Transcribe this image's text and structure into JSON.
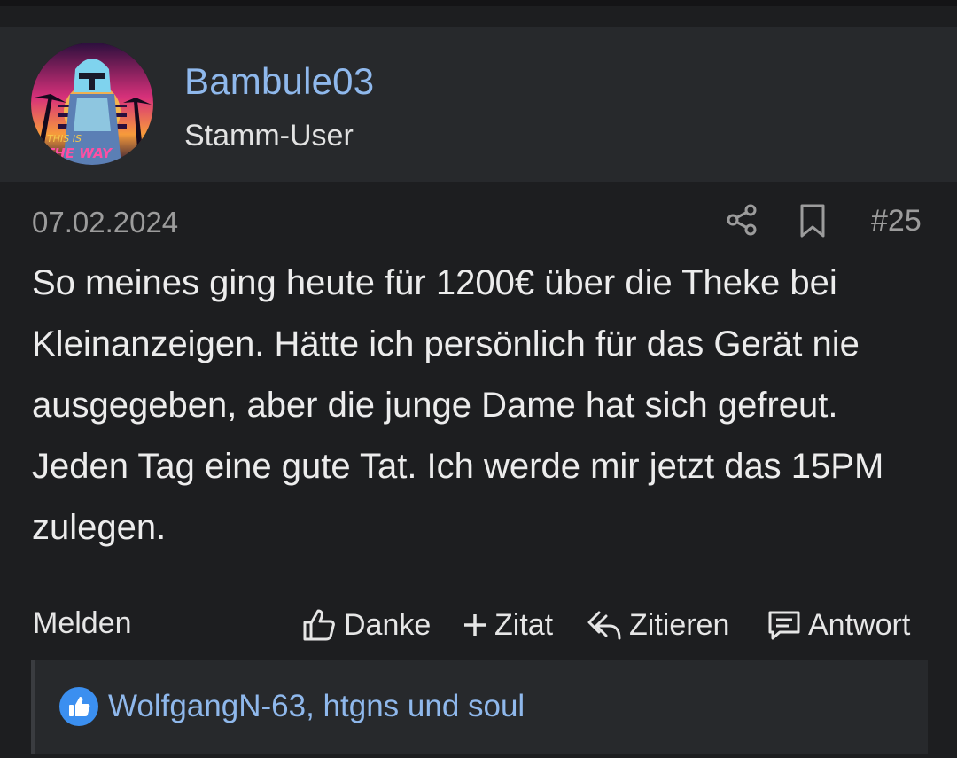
{
  "author": {
    "username": "Bambule03",
    "title": "Stamm-User",
    "avatar_text_line1": "THIS IS",
    "avatar_text_line2": "THE WAY"
  },
  "post": {
    "date": "07.02.2024",
    "number": "#25",
    "body": "So meines ging heute für 1200€ über die Theke bei Kleinanzeigen. Hätte ich persönlich für das Gerät nie ausgegeben, aber die junge Dame hat sich gefreut. Jeden Tag eine gute Tat. Ich werde mir jetzt das 15PM zulegen."
  },
  "actions": {
    "report": "Melden",
    "like": "Danke",
    "quote_add": "Zitat",
    "quote": "Zitieren",
    "reply": "Antwort"
  },
  "reactions": {
    "users": "WolfgangN-63, htgns und soul"
  },
  "icons": {
    "share": "share-icon",
    "bookmark": "bookmark-icon",
    "like": "thumbs-up-icon",
    "quote_add": "plus-icon",
    "quote": "reply-arrow-icon",
    "reply": "comment-icon",
    "reaction": "like-badge-icon"
  },
  "colors": {
    "link": "#8fb8ec",
    "background": "#1d1e20",
    "panel": "#27292c",
    "like_badge": "#3b8ff0"
  }
}
